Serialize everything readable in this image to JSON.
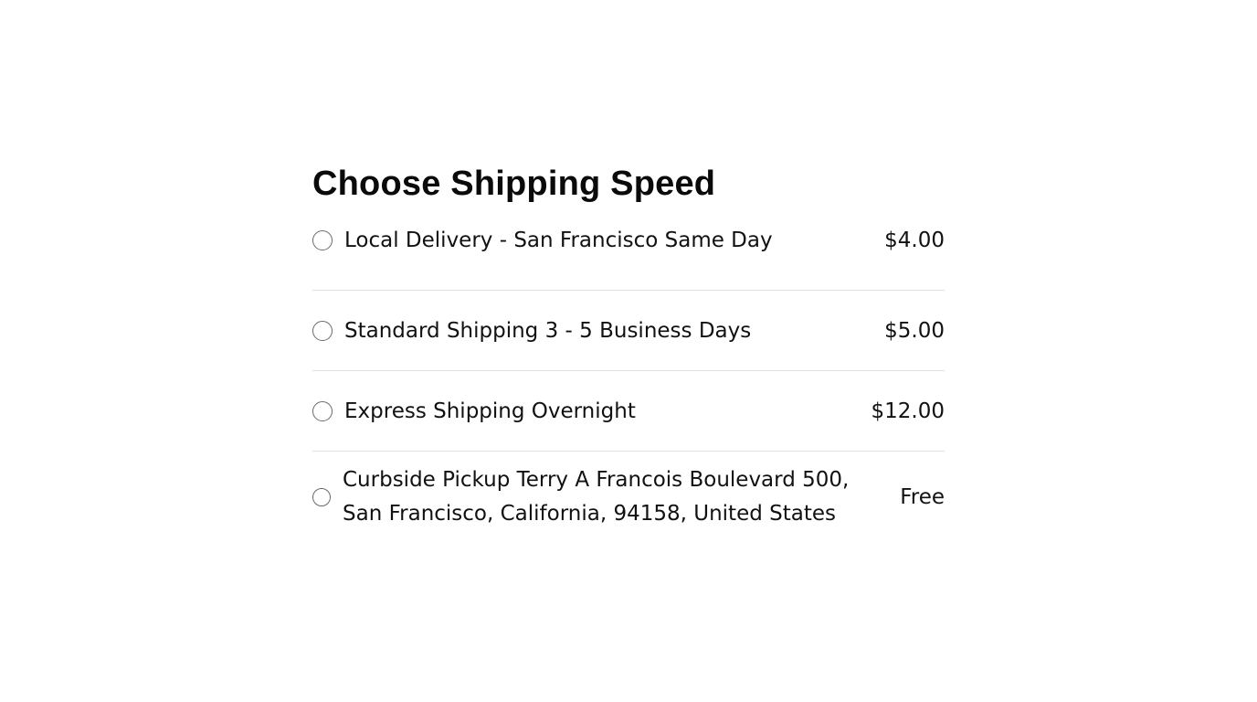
{
  "page_title": "Choose Shipping Speed",
  "options": [
    {
      "label": "Local Delivery - San Francisco Same Day",
      "price": "$4.00",
      "selected": false
    },
    {
      "label": "Standard Shipping 3 - 5 Business Days",
      "price": "$5.00",
      "selected": false
    },
    {
      "label": "Express Shipping Overnight",
      "price": "$12.00",
      "selected": false
    },
    {
      "label": "Curbside Pickup Terry A Francois Boulevard 500, San Francisco, California, 94158, United States",
      "price": "Free",
      "selected": false
    }
  ]
}
